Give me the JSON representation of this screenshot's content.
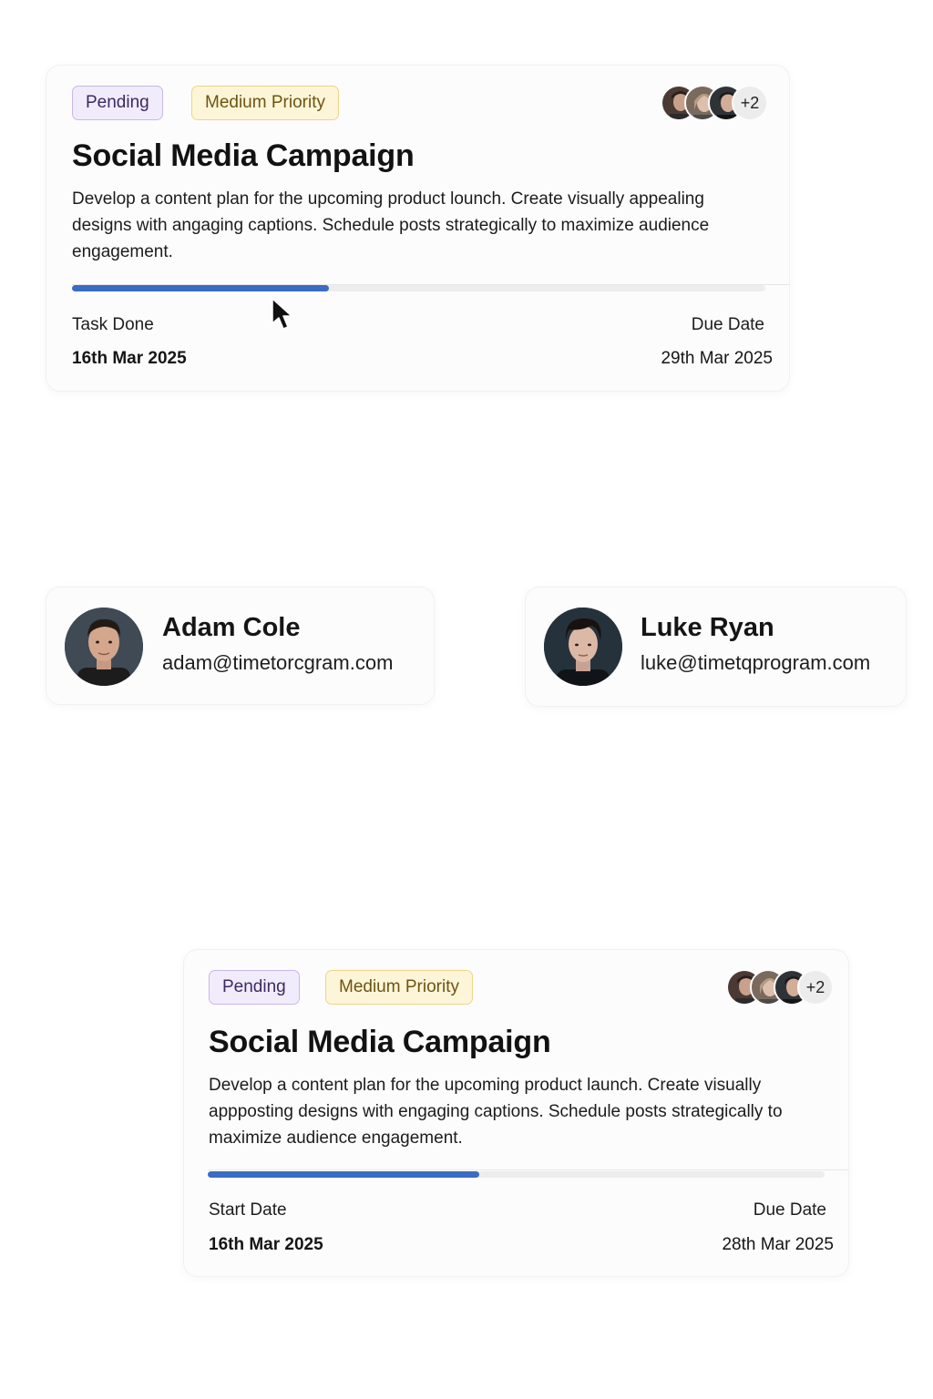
{
  "colors": {
    "progress": "#3a6cc3",
    "pending_bg": "#f1ecfb",
    "priority_bg": "#fdf5d8"
  },
  "task_cards": [
    {
      "status": "Pending",
      "priority": "Medium Priority",
      "extra_members": "+2",
      "title": "Social Media Campaign",
      "description": "Develop a content plan for the upcoming product lounch. Create visually appealing designs with angaging captions. Schedule posts strategically to maximize audience engagement.",
      "progress_fraction": 0.37,
      "start_label": "Task Done",
      "start_value": "16th Mar 2025",
      "due_label": "Due Date",
      "due_value": "29th Mar 2025"
    },
    {
      "status": "Pending",
      "priority": "Medium Priority",
      "extra_members": "+2",
      "title": "Social Media Campaign",
      "description": "Develop a content plan for the upcoming product launch. Create visually appposting designs with engaging captions. Schedule posts strategically to maximize audience engagement.",
      "progress_fraction": 0.44,
      "start_label": "Start Date",
      "start_value": "16th Mar 2025",
      "due_label": "Due Date",
      "due_value": "28th Mar 2025"
    }
  ],
  "users": [
    {
      "name": "Adam Cole",
      "email": "adam@timetorcgram.com",
      "avatar_icon": "man-portrait-avatar"
    },
    {
      "name": "Luke Ryan",
      "email": "luke@timetqprogram.com",
      "avatar_icon": "man-portrait-avatar"
    }
  ],
  "cursor_icon": "mouse-pointer-icon"
}
